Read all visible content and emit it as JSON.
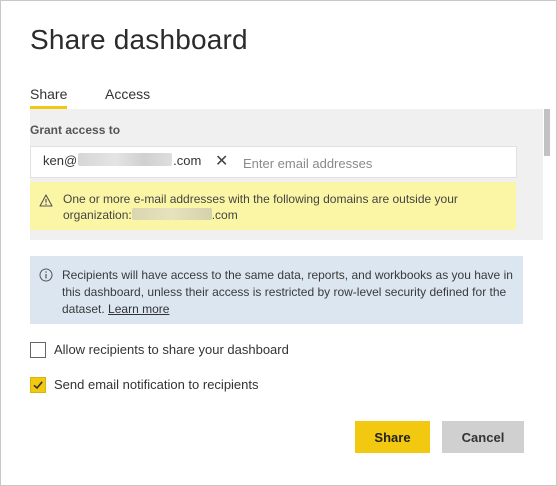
{
  "dialog": {
    "title": "Share dashboard",
    "tabs": [
      {
        "label": "Share",
        "active": true
      },
      {
        "label": "Access",
        "active": false
      }
    ]
  },
  "grant": {
    "label": "Grant access to",
    "chip_prefix": "ken@",
    "chip_suffix": ".com",
    "chip_close": "✕",
    "placeholder": "Enter email addresses",
    "warning_text_1": "One or more e-mail addresses with the following domains are outside your organization:",
    "warning_text_2": ".com"
  },
  "info": {
    "text": "Recipients will have access to the same data, reports, and workbooks as you have in this dashboard, unless their access is restricted by row-level security defined for the dataset.",
    "link": "Learn more"
  },
  "options": [
    {
      "label": "Allow recipients to share your dashboard",
      "checked": false
    },
    {
      "label": "Send email notification to recipients",
      "checked": true
    }
  ],
  "buttons": {
    "share": "Share",
    "cancel": "Cancel"
  },
  "colors": {
    "accent": "#f2c811",
    "warning_bg": "#fbf6a6",
    "info_bg": "#dce6f1",
    "panel_bg": "#f0f0f0"
  }
}
